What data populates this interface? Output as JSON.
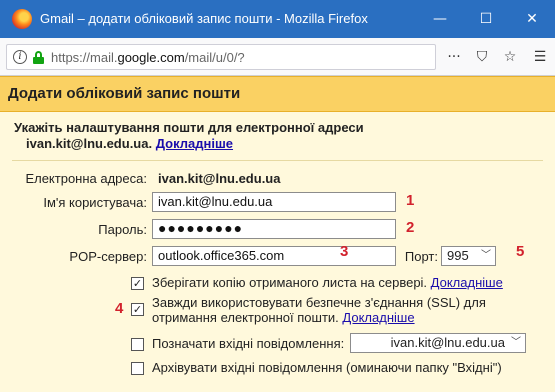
{
  "window": {
    "title": "Gmail – додати обліковий запис пошти - Mozilla Firefox",
    "minimize": "—",
    "maximize": "☐",
    "close": "✕"
  },
  "toolbar": {
    "url_prefix": "https://mail.",
    "url_domain": "google.com",
    "url_suffix": "/mail/u/0/?",
    "more": "···",
    "pocket": "⛉",
    "bookmark": "☆",
    "menu": "☰"
  },
  "header": {
    "title": "Додати обліковий запис пошти"
  },
  "instructions": {
    "line1": "Укажіть налаштування пошти для електронної адреси",
    "email": "ivan.kit@lnu.edu.ua.",
    "learn_more": "Докладніше"
  },
  "form": {
    "email_label": "Електронна адреса:",
    "email_value": "ivan.kit@lnu.edu.ua",
    "username_label": "Ім'я користувача:",
    "username_value": "ivan.kit@lnu.edu.ua",
    "password_label": "Пароль:",
    "password_value": "●●●●●●●●●",
    "pop_label": "POP-сервер:",
    "pop_value": "outlook.office365.com",
    "port_label": "Порт:",
    "port_value": "995",
    "marker_1": "1",
    "marker_2": "2",
    "marker_3": "3",
    "marker_4": "4",
    "marker_5": "5"
  },
  "options": {
    "keep_copy": "Зберігати копію отриманого листа на сервері.",
    "keep_copy_link": "Докладніше",
    "keep_copy_checked": true,
    "ssl_line1": "Завжди використовувати безпечне з'єднання (SSL) для",
    "ssl_line2": "отримання електронної пошти.",
    "ssl_link": "Докладніше",
    "ssl_checked": true,
    "label_incoming": "Позначати вхідні повідомлення:",
    "label_value": "ivan.kit@lnu.edu.ua",
    "archive": "Архівувати вхідні повідомлення (оминаючи папку \"Вхідні\")",
    "check_mark": "✓"
  },
  "colors": {
    "titlebar": "#2a6fc1",
    "header": "#fad163",
    "panel": "#fff9dc",
    "marker": "#d2222d",
    "link": "#1a0dab"
  }
}
